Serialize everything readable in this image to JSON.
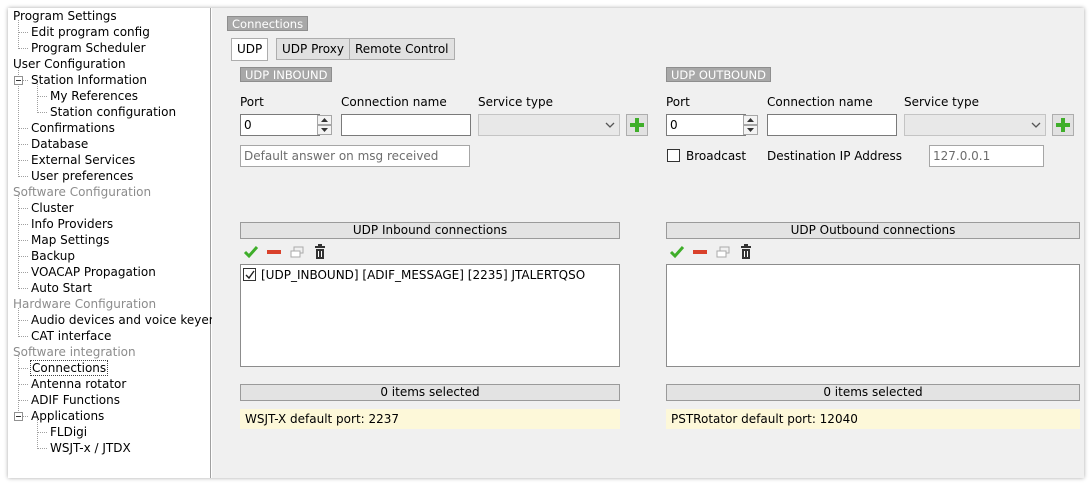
{
  "tree": {
    "items": [
      {
        "label": "Program Settings",
        "kind": "group"
      },
      {
        "label": "Edit program config",
        "kind": "child"
      },
      {
        "label": "Program Scheduler",
        "kind": "child"
      },
      {
        "label": "User Configuration",
        "kind": "group"
      },
      {
        "label": "Station Information",
        "kind": "child"
      },
      {
        "label": "My References",
        "kind": "grandchild"
      },
      {
        "label": "Station configuration",
        "kind": "grandchild"
      },
      {
        "label": "Confirmations",
        "kind": "child"
      },
      {
        "label": "Database",
        "kind": "child"
      },
      {
        "label": "External Services",
        "kind": "child"
      },
      {
        "label": "User preferences",
        "kind": "child"
      },
      {
        "label": "Software Configuration",
        "kind": "group-gray"
      },
      {
        "label": "Cluster",
        "kind": "child"
      },
      {
        "label": "Info Providers",
        "kind": "child"
      },
      {
        "label": "Map Settings",
        "kind": "child"
      },
      {
        "label": "Backup",
        "kind": "child"
      },
      {
        "label": "VOACAP Propagation",
        "kind": "child"
      },
      {
        "label": "Auto Start",
        "kind": "child"
      },
      {
        "label": "Hardware Configuration",
        "kind": "group-gray"
      },
      {
        "label": "Audio devices and voice keyer",
        "kind": "child"
      },
      {
        "label": "CAT interface",
        "kind": "child"
      },
      {
        "label": "Software integration",
        "kind": "group-gray"
      },
      {
        "label": "Connections",
        "kind": "child",
        "selected": true
      },
      {
        "label": "Antenna rotator",
        "kind": "child"
      },
      {
        "label": "ADIF Functions",
        "kind": "child"
      },
      {
        "label": "Applications",
        "kind": "child"
      },
      {
        "label": "FLDigi",
        "kind": "grandchild"
      },
      {
        "label": "WSJT-x / JTDX",
        "kind": "grandchild"
      }
    ]
  },
  "main": {
    "section_title": "Connections",
    "tabs": [
      {
        "label": "UDP",
        "active": true
      },
      {
        "label": "UDP Proxy",
        "active": false
      },
      {
        "label": "Remote Control",
        "active": false
      }
    ],
    "inbound": {
      "title": "UDP INBOUND",
      "port_label": "Port",
      "port_value": "0",
      "connection_name_label": "Connection name",
      "connection_name_value": "",
      "service_type_label": "Service type",
      "default_answer_placeholder": "Default answer on msg received",
      "grid_title": "UDP Inbound connections",
      "items": [
        {
          "checked": true,
          "text": "[UDP_INBOUND] [ADIF_MESSAGE] [2235] JTALERTQSO"
        }
      ],
      "status": "0 items selected",
      "hint": "WSJT-X default port: 2237"
    },
    "outbound": {
      "title": "UDP OUTBOUND",
      "port_label": "Port",
      "port_value": "0",
      "connection_name_label": "Connection name",
      "connection_name_value": "",
      "service_type_label": "Service type",
      "broadcast_label": "Broadcast",
      "broadcast_checked": false,
      "dest_ip_label": "Destination IP Address",
      "dest_ip_placeholder": "127.0.0.1",
      "grid_title": "UDP Outbound connections",
      "items": [],
      "status": "0 items selected",
      "hint": "PSTRotator default port: 12040"
    }
  },
  "colors": {
    "hint_bg": "#fdf8d9",
    "section_tag_bg": "#a8a8a8",
    "add_icon": "#3fae2a",
    "check_icon": "#3fae2a",
    "remove_icon": "#d9412b"
  },
  "icons": {
    "add": "plus-icon",
    "enable": "check-icon",
    "remove": "minus-icon",
    "copy": "copy-icon",
    "delete": "trash-icon"
  }
}
